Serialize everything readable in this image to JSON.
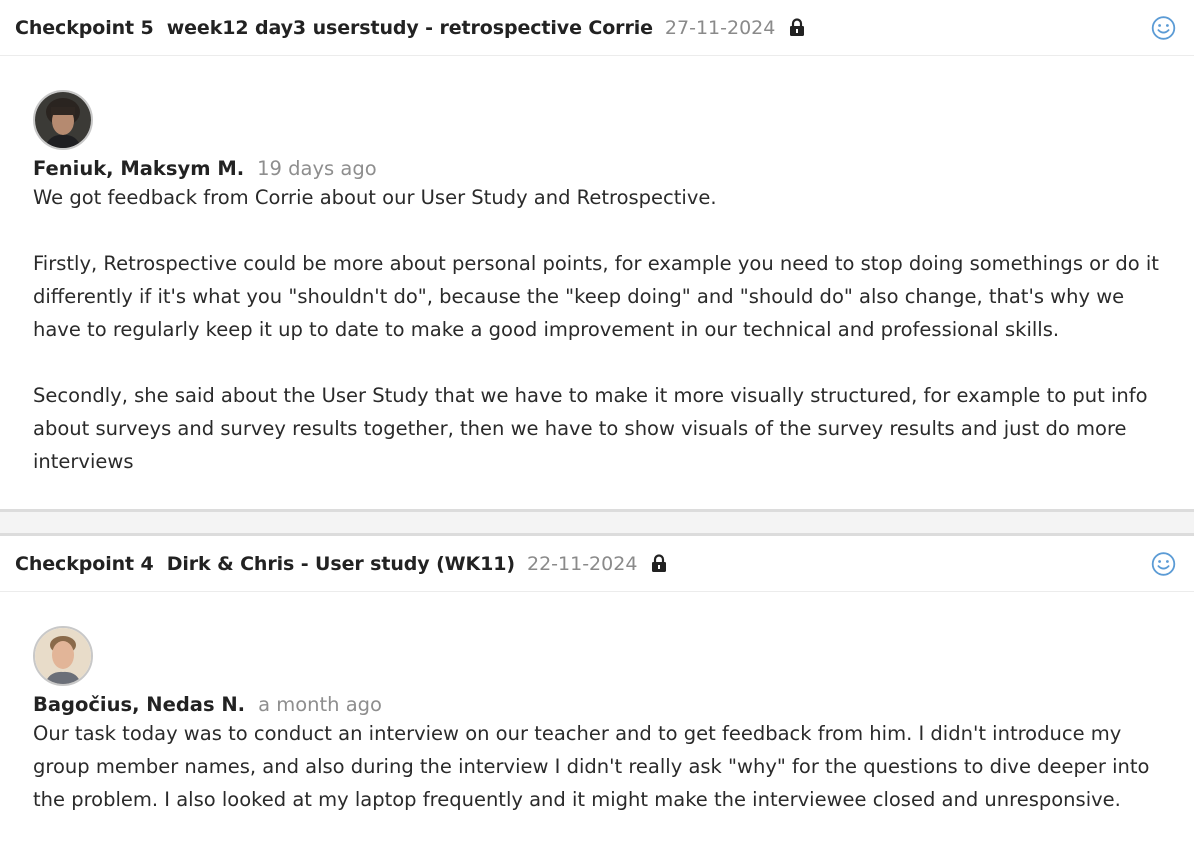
{
  "checkpoints": [
    {
      "title": "Checkpoint 5  week12 day3 userstudy - retrospective Corrie",
      "date": "27-11-2024",
      "lock_icon": "lock-icon",
      "reaction_icon": "smiley-icon",
      "comment": {
        "author": "Feniuk, Maksym M.",
        "time": "19 days ago",
        "paragraphs": [
          "We got feedback from Corrie about our User Study and Retrospective.",
          "Firstly, Retrospective could be more about personal points, for example you need to stop doing somethings or do it differently if it's what you \"shouldn't do\", because the \"keep doing\" and \"should do\" also change, that's why we have to regularly keep it up to date to make a good improvement in our technical and professional skills.",
          "Secondly, she said about the User Study that we have to make it more visually structured, for example to put info about surveys and survey results together, then we have to show visuals of the survey results and just do more interviews"
        ]
      }
    },
    {
      "title": "Checkpoint 4  Dirk & Chris - User study (WK11)",
      "date": "22-11-2024",
      "lock_icon": "lock-icon",
      "reaction_icon": "smiley-icon",
      "comment": {
        "author": "Bagočius, Nedas N.",
        "time": "a month ago",
        "paragraphs": [
          "Our task today was to conduct an interview on our teacher and to get feedback from him. I didn't introduce my group member names, and also during the interview I didn't really ask \"why\" for the questions to dive deeper into the problem. I also looked at my laptop frequently and it might make the interviewee closed and unresponsive."
        ]
      }
    }
  ],
  "colors": {
    "accent_icon": "#5b9bd5",
    "muted_text": "#8a8a8a",
    "separator": "#dcdcdc"
  }
}
